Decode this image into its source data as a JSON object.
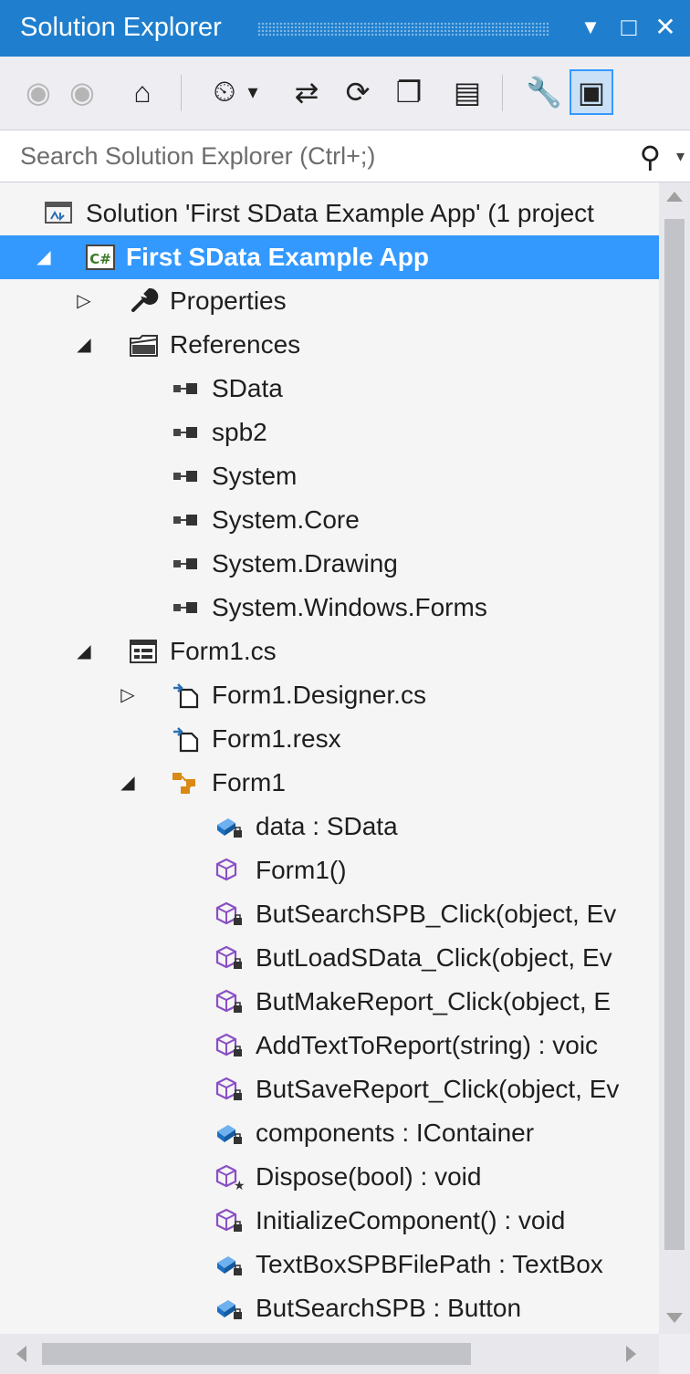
{
  "window": {
    "title": "Solution Explorer",
    "dropdown_icon": "▼",
    "maximize_icon": "□",
    "close_icon": "✕"
  },
  "toolbar": [
    {
      "name": "back-button",
      "icon": "back-icon",
      "glyph": "◉",
      "disabled": true
    },
    {
      "name": "forward-button",
      "icon": "forward-icon",
      "glyph": "◉",
      "disabled": true
    },
    {
      "name": "home-button",
      "icon": "home-icon",
      "glyph": "⌂"
    },
    {
      "name": "pending-changes-filter-button",
      "icon": "clock-filter-icon",
      "glyph": "⏲"
    },
    {
      "name": "pending-changes-dropdown",
      "icon": "chevron-down-icon",
      "glyph": "▾"
    },
    {
      "name": "sync-with-active-document-button",
      "icon": "sync-icon",
      "glyph": "⇄"
    },
    {
      "name": "refresh-button",
      "icon": "refresh-icon",
      "glyph": "⟳"
    },
    {
      "name": "collapse-all-button",
      "icon": "collapse-all-icon",
      "glyph": "❐"
    },
    {
      "name": "show-all-files-button",
      "icon": "show-all-files-icon",
      "glyph": "▤"
    },
    {
      "name": "properties-button",
      "icon": "wrench-icon",
      "glyph": "🔧"
    },
    {
      "name": "preview-selected-items-button",
      "icon": "preview-icon",
      "glyph": "▣",
      "active": true
    }
  ],
  "search": {
    "placeholder": "Search Solution Explorer (Ctrl+;)",
    "icon": "search-icon",
    "dropdown_icon": "chevron-down-icon"
  },
  "tree": [
    {
      "label": "Solution 'First SData Example App' (1 project",
      "icon": "solution-icon",
      "level": 0,
      "expander": "none"
    },
    {
      "label": "First SData Example App",
      "icon": "csharp-project-icon",
      "level": 0,
      "expander": "expanded",
      "selected": true
    },
    {
      "label": "Properties",
      "icon": "wrench-icon",
      "level": 1,
      "expander": "collapsed"
    },
    {
      "label": "References",
      "icon": "references-folder-icon",
      "level": 1,
      "expander": "expanded"
    },
    {
      "label": "SData",
      "icon": "reference-icon",
      "level": 2,
      "expander": "none"
    },
    {
      "label": "spb2",
      "icon": "reference-icon",
      "level": 2,
      "expander": "none"
    },
    {
      "label": "System",
      "icon": "reference-icon",
      "level": 2,
      "expander": "none"
    },
    {
      "label": "System.Core",
      "icon": "reference-icon",
      "level": 2,
      "expander": "none"
    },
    {
      "label": "System.Drawing",
      "icon": "reference-icon",
      "level": 2,
      "expander": "none"
    },
    {
      "label": "System.Windows.Forms",
      "icon": "reference-icon",
      "level": 2,
      "expander": "none"
    },
    {
      "label": "Form1.cs",
      "icon": "form-icon",
      "level": 1,
      "expander": "expanded"
    },
    {
      "label": "Form1.Designer.cs",
      "icon": "designer-file-icon",
      "level": 2,
      "expander": "collapsed"
    },
    {
      "label": "Form1.resx",
      "icon": "resx-file-icon",
      "level": 2,
      "expander": "none"
    },
    {
      "label": "Form1",
      "icon": "class-icon",
      "level": 2,
      "expander": "expanded"
    },
    {
      "label": "data : SData",
      "icon": "private-field-icon",
      "level": 3,
      "expander": "none"
    },
    {
      "label": "Form1()",
      "icon": "method-icon",
      "level": 3,
      "expander": "none"
    },
    {
      "label": "ButSearchSPB_Click(object, Ev",
      "icon": "private-method-icon",
      "level": 3,
      "expander": "none"
    },
    {
      "label": "ButLoadSData_Click(object, Ev",
      "icon": "private-method-icon",
      "level": 3,
      "expander": "none"
    },
    {
      "label": "ButMakeReport_Click(object, E",
      "icon": "private-method-icon",
      "level": 3,
      "expander": "none"
    },
    {
      "label": "AddTextToReport(string) : voic",
      "icon": "private-method-icon",
      "level": 3,
      "expander": "none"
    },
    {
      "label": "ButSaveReport_Click(object, Ev",
      "icon": "private-method-icon",
      "level": 3,
      "expander": "none"
    },
    {
      "label": "components : IContainer",
      "icon": "private-field-icon",
      "level": 3,
      "expander": "none"
    },
    {
      "label": "Dispose(bool) : void",
      "icon": "protected-method-icon",
      "level": 3,
      "expander": "none"
    },
    {
      "label": "InitializeComponent() : void",
      "icon": "private-method-icon",
      "level": 3,
      "expander": "none"
    },
    {
      "label": "TextBoxSPBFilePath : TextBox",
      "icon": "private-field-icon",
      "level": 3,
      "expander": "none"
    },
    {
      "label": "ButSearchSPB : Button",
      "icon": "private-field-icon",
      "level": 3,
      "expander": "none"
    }
  ],
  "colors": {
    "accent": "#1f7fce",
    "selection": "#3399ff",
    "method": "#8a4fc5",
    "field": "#1c6fc4",
    "class": "#d98a14"
  }
}
